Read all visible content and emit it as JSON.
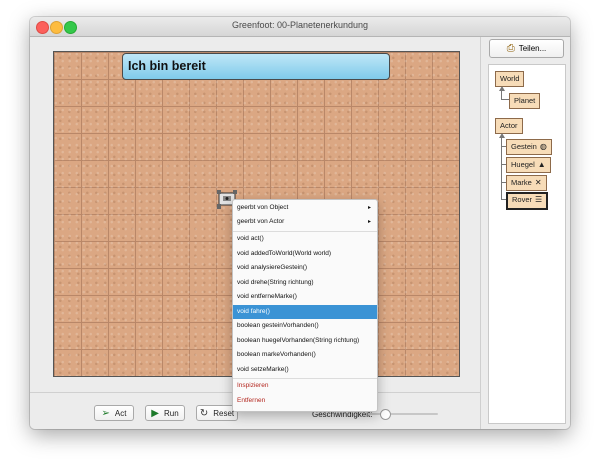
{
  "window": {
    "title": "Greenfoot: 00-Planetenerkundung"
  },
  "world": {
    "message": "Ich bin bereit"
  },
  "controls": {
    "act_label": "Act",
    "run_label": "Run",
    "reset_label": "Reset",
    "speed_label": "Geschwindigkeit:",
    "speed_value": 0.2
  },
  "share": {
    "label": "Teilen..."
  },
  "classes": {
    "world": "World",
    "planet": "Planet",
    "actor": "Actor",
    "gestein": "Gestein",
    "huegel": "Huegel",
    "marke": "Marke",
    "rover": "Rover"
  },
  "context_menu": {
    "inherited": [
      "geerbt von Object",
      "geerbt von Actor"
    ],
    "methods": [
      "void act()",
      "void addedToWorld(World world)",
      "void analysiereGestein()",
      "void drehe(String richtung)",
      "void entferneMarke()",
      "void fahre()",
      "boolean gesteinVorhanden()",
      "boolean huegelVorhanden(String richtung)",
      "boolean markeVorhanden()",
      "void setzeMarke()"
    ],
    "actions": [
      "Inspizieren",
      "Entfernen"
    ],
    "submenu_glyph": "▸"
  }
}
